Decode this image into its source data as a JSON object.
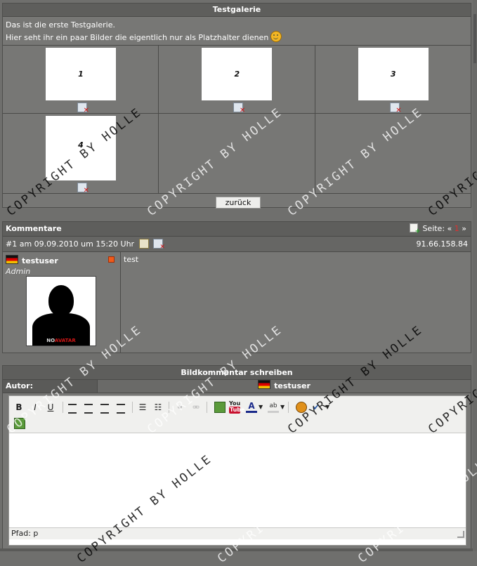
{
  "gallery": {
    "title": "Testgalerie",
    "intro_line1": "Das ist die erste Testgalerie.",
    "intro_line2": "Hier seht ihr ein paar Bilder die eigentlich nur als Platzhalter dienen",
    "images": [
      {
        "label": "1"
      },
      {
        "label": "2"
      },
      {
        "label": "3"
      },
      {
        "label": "4"
      }
    ],
    "back_button": "zurück"
  },
  "comments": {
    "title": "Kommentare",
    "pager_label": "Seite:",
    "pager_prev": "«",
    "pager_current": "1",
    "pager_next": "»",
    "entry": {
      "header": "#1 am 09.09.2010 um 15:20 Uhr",
      "ip": "91.66.158.84",
      "username": "testuser",
      "role": "Admin",
      "text": "test",
      "avatar_label_a": "NO",
      "avatar_label_b": "AVATAR"
    }
  },
  "editor": {
    "title": "Bildkommentar schreiben",
    "author_label": "Autor:",
    "author_name": "testuser",
    "path_label": "Pfad: p",
    "icons": [
      "bold-icon",
      "italic-icon",
      "underline-icon",
      "align-left-icon",
      "align-center-icon",
      "align-right-icon",
      "justify-icon",
      "bullet-list-icon",
      "numbered-list-icon",
      "link-icon",
      "unlink-icon",
      "image-icon",
      "youtube-icon",
      "font-color-icon",
      "highlight-icon",
      "smiley-icon",
      "spellcheck-icon",
      "insert-image-icon"
    ]
  },
  "watermark": "COPYRIGHT BY HOLLE",
  "colors": {
    "background": "#6f6f6d",
    "header": "#5e5e5c",
    "delete_red": "#d01616"
  }
}
